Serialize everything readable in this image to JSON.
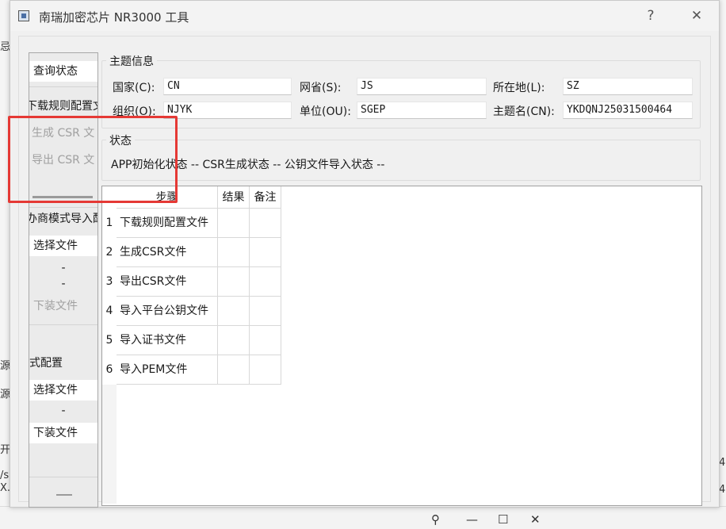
{
  "window": {
    "title": "南瑞加密芯片 NR3000 工具",
    "help_icon": "?",
    "close_icon": "✕"
  },
  "left_panel": {
    "query_status": "查询状态",
    "download_rules": "下载规则配置文",
    "generate_csr": "生成 CSR 文",
    "export_csr": "导出 CSR 文",
    "vendor_mode_import": "办商模式导入配",
    "select_file_1": "选择文件",
    "dash_1": "-",
    "dash_2": "-",
    "download_file_1": "下装文件",
    "mode_config": "式配置",
    "select_file_2": "选择文件",
    "dash_3": "-",
    "download_file_2": "下装文件"
  },
  "subject_info": {
    "title": "主题信息",
    "country_label": "国家(C):",
    "country_value": "CN",
    "province_label": "网省(S):",
    "province_value": "JS",
    "location_label": "所在地(L):",
    "location_value": "SZ",
    "org_label": "组织(O):",
    "org_value": "NJYK",
    "unit_label": "单位(OU):",
    "unit_value": "SGEP",
    "subject_label": "主题名(CN):",
    "subject_value": "YKDQNJ25031500464"
  },
  "status": {
    "title": "状态",
    "text": "APP初始化状态 -- CSR生成状态 -- 公钥文件导入状态 --"
  },
  "table": {
    "headers": [
      "步骤",
      "结果",
      "备注"
    ],
    "rows": [
      {
        "num": "1",
        "step": "下载规则配置文件",
        "result": "",
        "note": ""
      },
      {
        "num": "2",
        "step": "生成CSR文件",
        "result": "",
        "note": ""
      },
      {
        "num": "3",
        "step": "导出CSR文件",
        "result": "",
        "note": ""
      },
      {
        "num": "4",
        "step": "导入平台公钥文件",
        "result": "",
        "note": ""
      },
      {
        "num": "5",
        "step": "导入证书文件",
        "result": "",
        "note": ""
      },
      {
        "num": "6",
        "step": "导入PEM文件",
        "result": "",
        "note": ""
      }
    ]
  },
  "background": {
    "left_glyph_1": "忌",
    "left_glyph_2": "源",
    "left_glyph_3": "源",
    "left_glyph_4": "开",
    "left_glyph_5": "/s",
    "left_glyph_6": "X.",
    "right_glyph_1": "4",
    "right_glyph_2": "4",
    "pin_icon": "⚲",
    "minimize_icon": "—",
    "maximize_icon": "☐",
    "close_icon": "✕"
  }
}
